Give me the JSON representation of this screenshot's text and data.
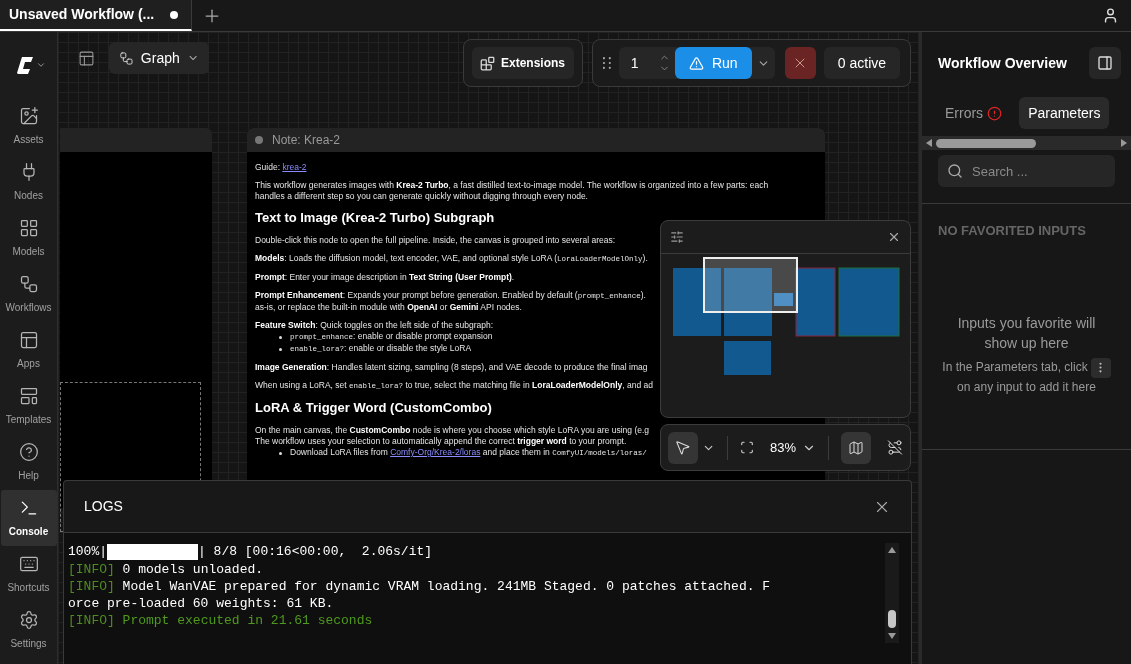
{
  "tabs": [
    {
      "title": "Unsaved Workflow (...",
      "selected": true,
      "modified": true
    }
  ],
  "sidebar": {
    "items": [
      {
        "kind": "assets",
        "label": "Assets",
        "selected": false
      },
      {
        "kind": "nodes",
        "label": "Nodes",
        "selected": false
      },
      {
        "kind": "models",
        "label": "Models",
        "selected": false
      },
      {
        "kind": "workflows",
        "label": "Workflows",
        "selected": false
      },
      {
        "kind": "apps",
        "label": "Apps",
        "selected": false
      },
      {
        "kind": "templates",
        "label": "Templates",
        "selected": false
      },
      {
        "kind": "help",
        "label": "Help",
        "selected": false
      },
      {
        "kind": "console",
        "label": "Console",
        "selected": true
      },
      {
        "kind": "shortcuts",
        "label": "Shortcuts",
        "selected": false
      },
      {
        "kind": "settings",
        "label": "Settings",
        "selected": false
      }
    ]
  },
  "toolbar": {
    "view": "Graph",
    "extensions": "Extensions",
    "batch_count": "1",
    "run": "Run",
    "active": "0 active"
  },
  "note": {
    "title": "Note: Krea-2",
    "lines": [
      {
        "kind": "p",
        "segments": [
          {
            "kind": "text",
            "text": "Guide: "
          },
          {
            "kind": "link",
            "text": "krea-2"
          }
        ]
      },
      {
        "kind": "p",
        "segments": [
          {
            "kind": "text",
            "text": "This workflow generates images with "
          },
          {
            "kind": "bold",
            "text": "Krea-2 Turbo"
          },
          {
            "kind": "text",
            "text": ", a fast distilled text-to-image model. The workflow is organized into a few parts: each"
          }
        ]
      },
      {
        "kind": "cont",
        "segments": [
          {
            "kind": "text",
            "text": "handles a different step so you can generate quickly without digging through every node."
          }
        ]
      },
      {
        "kind": "h",
        "segments": [
          {
            "kind": "text",
            "text": "Text to Image (Krea-2 Turbo) Subgraph"
          }
        ]
      },
      {
        "kind": "p",
        "segments": [
          {
            "kind": "text",
            "text": "Double-click this node to open the full pipeline. Inside, the canvas is grouped into several areas:"
          }
        ]
      },
      {
        "kind": "p",
        "segments": [
          {
            "kind": "bold",
            "text": "Models"
          },
          {
            "kind": "text",
            "text": ": Loads the diffusion model, text encoder, VAE, and optional style LoRA ("
          },
          {
            "kind": "code",
            "text": "LoraLoaderModelOnly"
          },
          {
            "kind": "text",
            "text": ")."
          }
        ]
      },
      {
        "kind": "p",
        "segments": [
          {
            "kind": "bold",
            "text": "Prompt"
          },
          {
            "kind": "text",
            "text": ": Enter your image description in "
          },
          {
            "kind": "bold",
            "text": "Text String (User Prompt)"
          },
          {
            "kind": "text",
            "text": "."
          }
        ]
      },
      {
        "kind": "p",
        "segments": [
          {
            "kind": "bold",
            "text": "Prompt Enhancement"
          },
          {
            "kind": "text",
            "text": ": Expands your prompt before generation. Enabled by default ("
          },
          {
            "kind": "code",
            "text": "prompt_enhance"
          },
          {
            "kind": "text",
            "text": ")."
          }
        ]
      },
      {
        "kind": "cont",
        "segments": [
          {
            "kind": "text",
            "text": "as-is, or replace the built-in module with "
          },
          {
            "kind": "bold",
            "text": "OpenAI"
          },
          {
            "kind": "text",
            "text": " or "
          },
          {
            "kind": "bold",
            "text": "Gemini"
          },
          {
            "kind": "text",
            "text": " API nodes."
          }
        ]
      },
      {
        "kind": "p",
        "segments": [
          {
            "kind": "bold",
            "text": "Feature Switch"
          },
          {
            "kind": "text",
            "text": ": Quick toggles on the left side of the subgraph:"
          }
        ]
      },
      {
        "kind": "li",
        "segments": [
          {
            "kind": "code",
            "text": "prompt_enhance"
          },
          {
            "kind": "text",
            "text": ": enable or disable prompt expansion"
          }
        ]
      },
      {
        "kind": "li",
        "segments": [
          {
            "kind": "code",
            "text": "enable_lora?"
          },
          {
            "kind": "text",
            "text": ": enable or disable the style LoRA"
          }
        ]
      },
      {
        "kind": "p",
        "segments": [
          {
            "kind": "bold",
            "text": "Image Generation"
          },
          {
            "kind": "text",
            "text": ": Handles latent sizing, sampling (8 steps), and VAE decode to produce the final imag"
          }
        ]
      },
      {
        "kind": "p",
        "segments": [
          {
            "kind": "text",
            "text": "When using a LoRA, set "
          },
          {
            "kind": "code",
            "text": "enable_lora?"
          },
          {
            "kind": "text",
            "text": " to true, select the matching file in "
          },
          {
            "kind": "bold",
            "text": "LoraLoaderModelOnly"
          },
          {
            "kind": "text",
            "text": ", and ad"
          }
        ]
      },
      {
        "kind": "h",
        "segments": [
          {
            "kind": "text",
            "text": "LoRA & Trigger Word (CustomCombo)"
          }
        ]
      },
      {
        "kind": "p",
        "segments": [
          {
            "kind": "text",
            "text": "On the main canvas, the "
          },
          {
            "kind": "bold",
            "text": "CustomCombo"
          },
          {
            "kind": "text",
            "text": " node is where you choose which style LoRA you are using (e.g"
          }
        ]
      },
      {
        "kind": "cont",
        "segments": [
          {
            "kind": "text",
            "text": "The workflow uses your selection to automatically append the correct "
          },
          {
            "kind": "bold",
            "text": "trigger word"
          },
          {
            "kind": "text",
            "text": " to your prompt."
          }
        ]
      },
      {
        "kind": "li",
        "segments": [
          {
            "kind": "text",
            "text": "Download LoRA files from "
          },
          {
            "kind": "link",
            "text": "Comfy-Org/Krea-2/loras"
          },
          {
            "kind": "text",
            "text": " and place them in "
          },
          {
            "kind": "code",
            "text": "ComfyUI/models/loras/"
          }
        ]
      }
    ]
  },
  "canvas_controls": {
    "pointer_selected": true,
    "zoom": "83%",
    "minimap_selected": true
  },
  "logs": {
    "title": "LOGS",
    "lines": [
      {
        "kind": "progress",
        "prefix": "100%|",
        "suffix": "| 8/8 [00:16<00:00,  2.06s/it]"
      },
      {
        "kind": "info",
        "tag": "[INFO]",
        "text": " 0 models unloaded."
      },
      {
        "kind": "info",
        "tag": "[INFO]",
        "text": " Model WanVAE prepared for dynamic VRAM loading. 241MB Staged. 0 patches attached. F"
      },
      {
        "kind": "plain",
        "text": "orce pre-loaded 60 weights: 61 KB."
      },
      {
        "kind": "success",
        "tag": "[INFO]",
        "text": " Prompt executed in 21.61 seconds"
      }
    ]
  },
  "panel": {
    "title": "Workflow Overview",
    "tabs": [
      {
        "label": "Errors",
        "selected": false,
        "alert": true
      },
      {
        "label": "Parameters",
        "selected": true,
        "alert": false
      }
    ],
    "search": {
      "placeholder": "Search ..."
    },
    "empty_heading": "NO FAVORITED INPUTS",
    "empty_title": "Inputs you favorite will show up here",
    "empty_hint_before": "In the Parameters tab, click",
    "empty_hint_after": "on any input to add it here"
  }
}
